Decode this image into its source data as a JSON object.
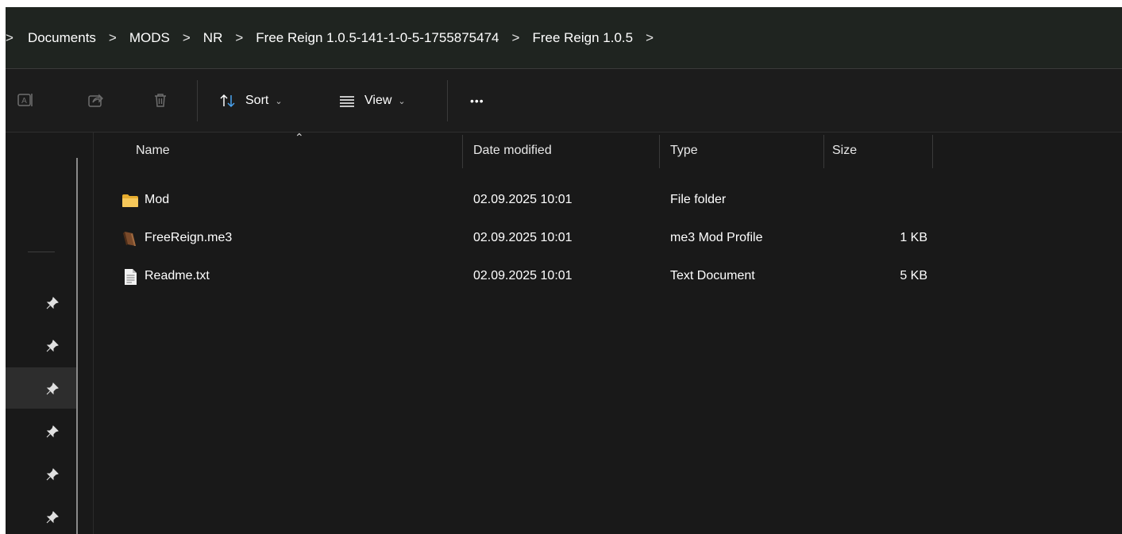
{
  "breadcrumb": {
    "leading_chevron": ">",
    "separator": ">",
    "items": [
      "Documents",
      "MODS",
      "NR",
      "Free Reign 1.0.5-141-1-0-5-1755875474",
      "Free Reign 1.0.5"
    ]
  },
  "toolbar": {
    "sort_label": "Sort",
    "view_label": "View",
    "more_label": "•••"
  },
  "columns": {
    "name": "Name",
    "date_modified": "Date modified",
    "type": "Type",
    "size": "Size"
  },
  "files": [
    {
      "icon": "folder-icon",
      "name": "Mod",
      "date": "02.09.2025 10:01",
      "type": "File folder",
      "size": ""
    },
    {
      "icon": "mod-profile-icon",
      "name": "FreeReign.me3",
      "date": "02.09.2025 10:01",
      "type": "me3 Mod Profile",
      "size": "1 KB"
    },
    {
      "icon": "text-document-icon",
      "name": "Readme.txt",
      "date": "02.09.2025 10:01",
      "type": "Text Document",
      "size": "5 KB"
    }
  ],
  "colors": {
    "background": "#191919",
    "addressbar": "#1f2420",
    "folder": "#f2c14e",
    "selected_nav": "#2d2d2d"
  }
}
